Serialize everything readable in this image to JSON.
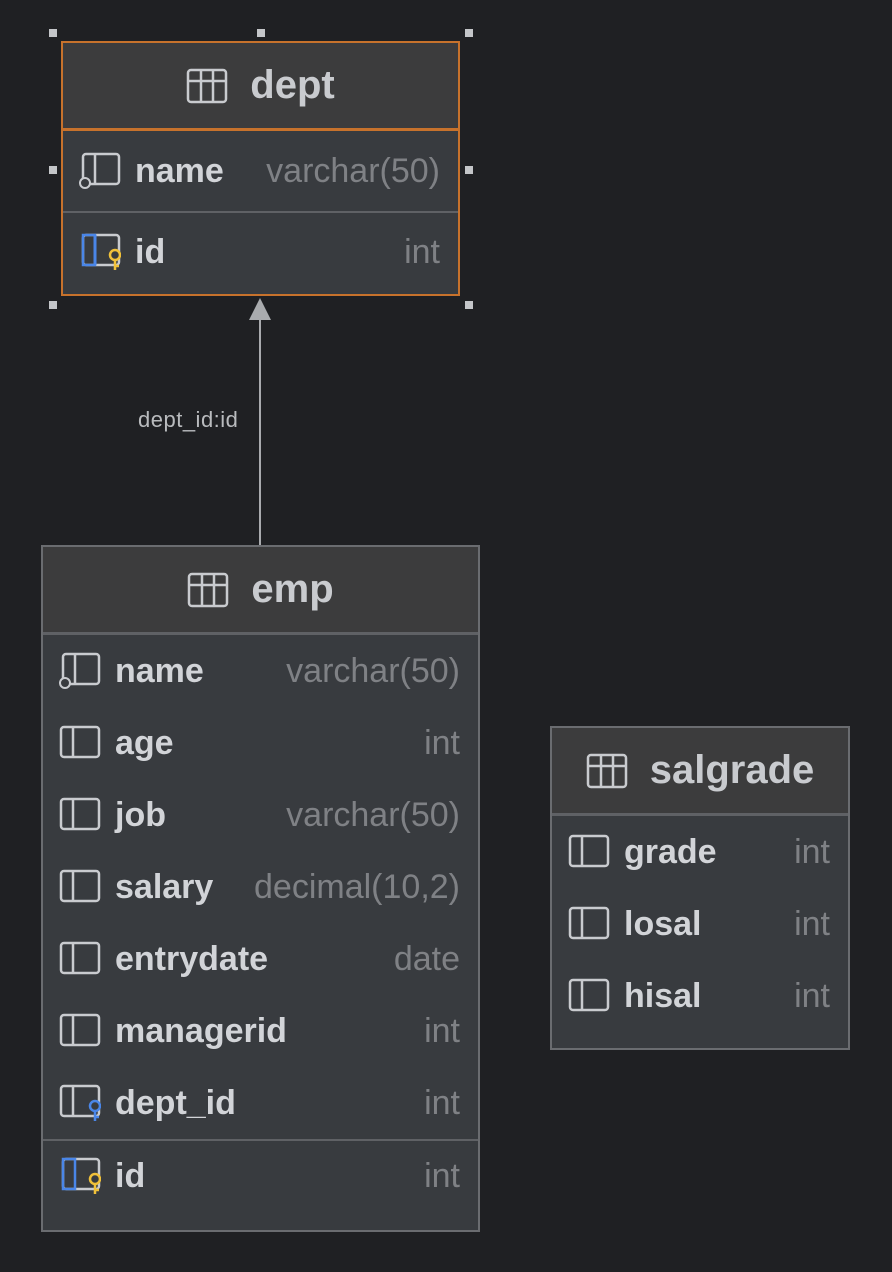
{
  "relationship": {
    "label": "dept_id:id"
  },
  "tables": {
    "dept": {
      "title": "dept",
      "columns": [
        {
          "name": "name",
          "type": "varchar(50)",
          "icon": "column-index-icon"
        },
        {
          "name": "id",
          "type": "int",
          "icon": "primary-key-icon"
        }
      ]
    },
    "emp": {
      "title": "emp",
      "columns": [
        {
          "name": "name",
          "type": "varchar(50)",
          "icon": "column-index-icon"
        },
        {
          "name": "age",
          "type": "int",
          "icon": "column-icon"
        },
        {
          "name": "job",
          "type": "varchar(50)",
          "icon": "column-icon"
        },
        {
          "name": "salary",
          "type": "decimal(10,2)",
          "icon": "column-icon"
        },
        {
          "name": "entrydate",
          "type": "date",
          "icon": "column-icon"
        },
        {
          "name": "managerid",
          "type": "int",
          "icon": "column-icon"
        },
        {
          "name": "dept_id",
          "type": "int",
          "icon": "foreign-key-icon"
        },
        {
          "name": "id",
          "type": "int",
          "icon": "primary-key-icon"
        }
      ]
    },
    "salgrade": {
      "title": "salgrade",
      "columns": [
        {
          "name": "grade",
          "type": "int",
          "icon": "column-icon"
        },
        {
          "name": "losal",
          "type": "int",
          "icon": "column-icon"
        },
        {
          "name": "hisal",
          "type": "int",
          "icon": "column-icon"
        }
      ]
    }
  },
  "colors": {
    "background": "#1f2023",
    "selection": "#c7722c",
    "primary_key": "#f0c13a",
    "foreign_key": "#4a86e8"
  }
}
